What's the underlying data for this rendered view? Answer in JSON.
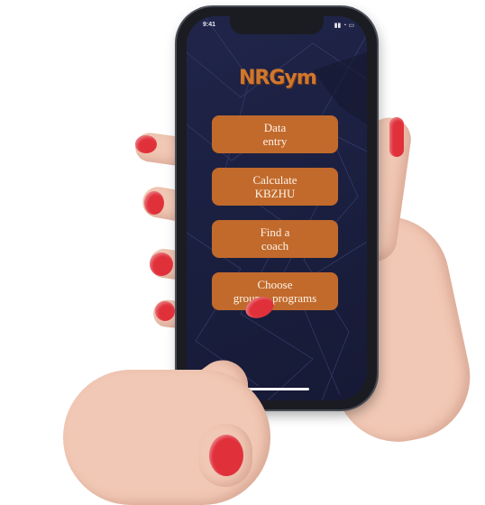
{
  "status_bar": {
    "time": "9:41",
    "icons": "▮▮ ◔ ▭"
  },
  "app": {
    "logo": "NRGym"
  },
  "menu": [
    {
      "line1": "Data",
      "line2": "entry"
    },
    {
      "line1": "Calculate",
      "line2": "KBZHU"
    },
    {
      "line1": "Find a",
      "line2": "coach"
    },
    {
      "line1": "Choose",
      "line2": "group    programs"
    }
  ],
  "colors": {
    "screen_bg": "#1d2244",
    "button": "#c16a2c",
    "logo": "#d0772e",
    "nail": "#e0303a"
  }
}
